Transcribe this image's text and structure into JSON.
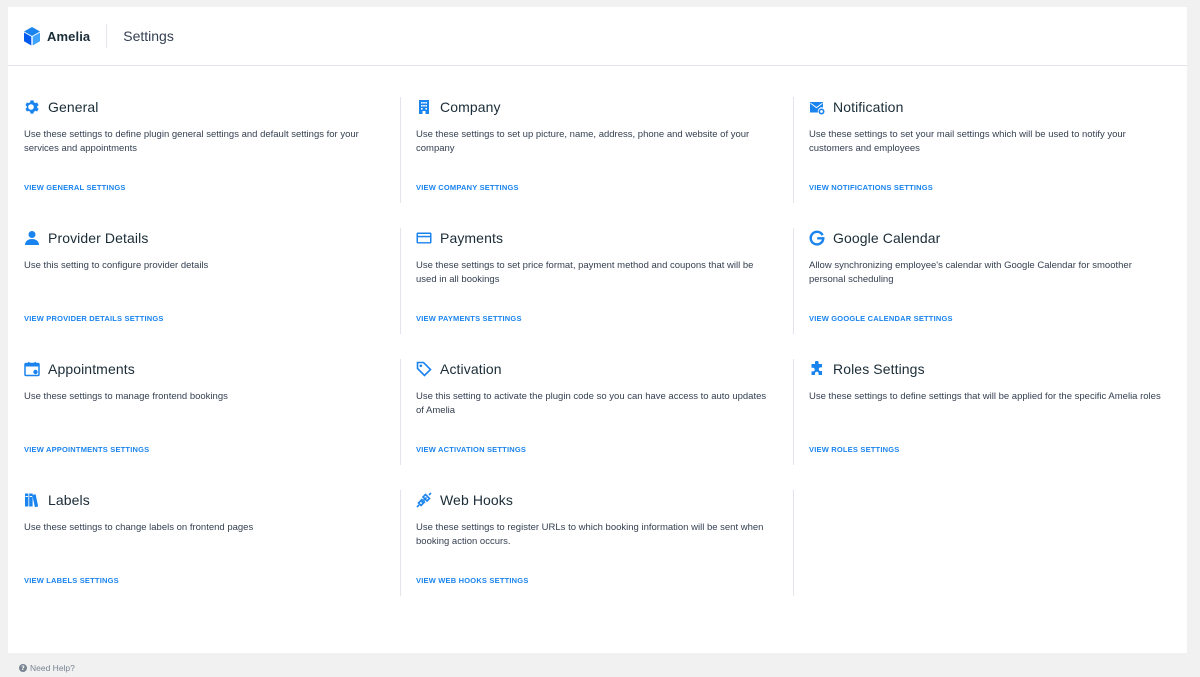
{
  "header": {
    "logo_text": "Amelia",
    "title": "Settings"
  },
  "colors": {
    "accent": "#1a84ee",
    "icon": "#1a84ee"
  },
  "cards": [
    {
      "title": "General",
      "icon": "gear-icon",
      "description": "Use these settings to define plugin general settings and default settings for your services and appointments",
      "link": "VIEW GENERAL SETTINGS"
    },
    {
      "title": "Company",
      "icon": "building-icon",
      "description": "Use these settings to set up picture, name, address, phone and website of your company",
      "link": "VIEW COMPANY SETTINGS"
    },
    {
      "title": "Notification",
      "icon": "envelope-icon",
      "description": "Use these settings to set your mail settings which will be used to notify your customers and employees",
      "link": "VIEW NOTIFICATIONS SETTINGS"
    },
    {
      "title": "Provider Details",
      "icon": "user-icon",
      "description": "Use this setting to configure provider details",
      "link": "VIEW PROVIDER DETAILS SETTINGS"
    },
    {
      "title": "Payments",
      "icon": "credit-card-icon",
      "description": "Use these settings to set price format, payment method and coupons that will be used in all bookings",
      "link": "VIEW PAYMENTS SETTINGS"
    },
    {
      "title": "Google Calendar",
      "icon": "google-icon",
      "description": "Allow synchronizing employee's calendar with Google Calendar for smoother personal scheduling",
      "link": "VIEW GOOGLE CALENDAR SETTINGS"
    },
    {
      "title": "Appointments",
      "icon": "calendar-icon",
      "description": "Use these settings to manage frontend bookings",
      "link": "VIEW APPOINTMENTS SETTINGS"
    },
    {
      "title": "Activation",
      "icon": "tag-icon",
      "description": "Use this setting to activate the plugin code so you can have access to auto updates of Amelia",
      "link": "VIEW ACTIVATION SETTINGS"
    },
    {
      "title": "Roles Settings",
      "icon": "puzzle-icon",
      "description": "Use these settings to define settings that will be applied for the specific Amelia roles",
      "link": "VIEW ROLES SETTINGS"
    },
    {
      "title": "Labels",
      "icon": "books-icon",
      "description": "Use these settings to change labels on frontend pages",
      "link": "VIEW LABELS SETTINGS"
    },
    {
      "title": "Web Hooks",
      "icon": "link-icon",
      "description": "Use these settings to register URLs to which booking information will be sent when booking action occurs.",
      "link": "VIEW WEB HOOKS SETTINGS"
    }
  ],
  "footer": {
    "help_text": "Need Help?"
  }
}
